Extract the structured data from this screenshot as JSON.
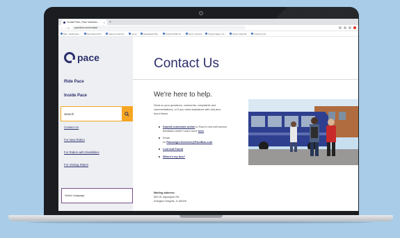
{
  "browser": {
    "tab_title": "Contact Pace | Pace Suburban ...",
    "tab_close": "×",
    "new_tab": "+",
    "nav_buttons": "← → C",
    "url": "pacebus.com/contact",
    "bookmarks": [
      "Mail - Global Area...",
      "Dear Microsoft P...",
      "Welcome Start W...",
      "Home",
      "Headquarter Bra...",
      "Schools Public W...",
      "Home / Art area",
      "Street Images / Fo...",
      "Library Collect B...",
      "Friends of Art..."
    ]
  },
  "sidebar": {
    "logo_text": "pace",
    "nav_primary": [
      "Ride Pace",
      "Inside Pace"
    ],
    "search_label": "Search",
    "links": [
      "Contact Us",
      "For New Riders",
      "For Riders with Disabilities",
      "For Visiting Riders"
    ],
    "language_label": "Select Language"
  },
  "main": {
    "title": "Contact Us",
    "subtitle": "We're here to help.",
    "intro": "Send us your questions, comments, complaints and commendations, or if you need assistance with lost-and-found items:",
    "item1_link": "Submit comments online",
    "item1_text": " to Pace's new self-service feedback center! Learn more ",
    "item1_here": "here",
    "item1_end": ".",
    "item2_text": "Email",
    "item2_prefix": "Email ",
    "item2_on": "on ",
    "item2_email": "Passenger.Services@PaceBus.com",
    "item3_link": "Lost and Found",
    "item4_link": "Where's my bus?",
    "mailing_label": "Mailing address:",
    "mailing_line1": "550 W. Algonquin Rd.",
    "mailing_line2": "Arlington Heights, IL 60005"
  },
  "colors": {
    "brand_navy": "#2b2f6b",
    "accent_orange": "#f6a623",
    "page_bg": "#a9cde8"
  },
  "icons": {
    "search": "search-icon",
    "camera": "camera-icon"
  }
}
